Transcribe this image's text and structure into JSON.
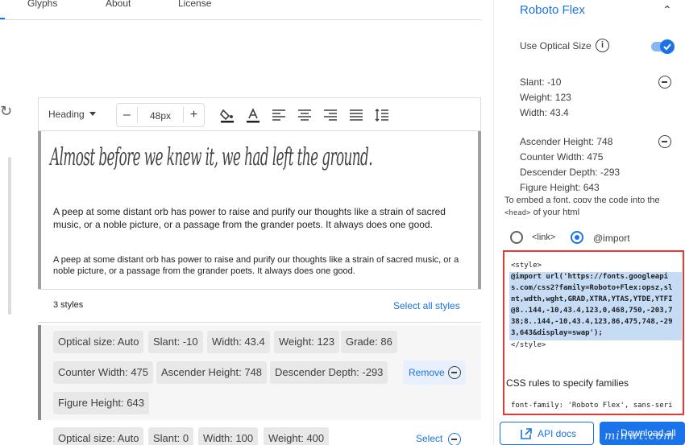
{
  "tabs": [
    "Glyphs",
    "About",
    "License"
  ],
  "toolbar": {
    "heading_select": "Heading",
    "size_minus": "–",
    "size_value": "48px",
    "size_plus": "+",
    "icons": [
      "fill-color-icon",
      "text-color-icon",
      "align-left-icon",
      "align-center-icon",
      "align-right-icon",
      "align-justify-icon",
      "line-height-icon"
    ]
  },
  "preview": {
    "heading": "Almost before we knew it, we had left the ground.",
    "paragraph_large": "A peep at some distant orb has power to raise and purify our thoughts like a strain of sacred music, or a noble picture, or a passage from the grander poets. It always does one good.",
    "paragraph_small": "A peep at some distant orb has power to raise and purify our thoughts like a strain of sacred music, or a noble picture, or a passage from the grander poets. It always does one good."
  },
  "styles": {
    "count_label": "3 styles",
    "select_all": "Select all styles",
    "style1_chips": [
      "Optical size: Auto",
      "Slant: -10",
      "Width: 43.4",
      "Weight: 123",
      "Grade: 86",
      "Counter Width: 475",
      "Ascender Height: 748",
      "Descender Depth: -293",
      "Figure Height: 643"
    ],
    "remove_label": "Remove",
    "style2_chips": [
      "Optical size: Auto",
      "Slant: 0",
      "Width: 100",
      "Weight: 400"
    ],
    "select_label": "Select"
  },
  "panel": {
    "family": "Roboto Flex",
    "optical_size_label": "Use Optical Size",
    "optical_size_on": true,
    "group1": [
      "Slant: -10",
      "Weight: 123",
      "Width: 43.4"
    ],
    "group2": [
      "Ascender Height: 748",
      "Counter Width: 475",
      "Descender Depth: -293",
      "Figure Height: 643"
    ],
    "embed_hint": "To embed a font, copy the code into the",
    "embed_hint_code": "<head>",
    "embed_hint_tail": " of your html",
    "radio_link": "<link>",
    "radio_import": "@import",
    "code_lines": [
      "<style>",
      "@import url('https://fonts.googleapi",
      "s.com/css2?family=Roboto+Flex:opsz,sl",
      "nt,wdth,wght,GRAD,XTRA,YTAS,YTDE,YTFI",
      "@8..144,-10,43.4,123,0,468,750,-203,7",
      "38;8..144,-10,43.4,123,86,475,748,-29",
      "3,643&display=swap');",
      "</style>"
    ],
    "css_rules_label": "CSS rules to specify families",
    "css_rule_code": "font-family: 'Roboto Flex', sans-seri",
    "api_docs": "API docs",
    "download_all": "Download all"
  },
  "watermark": "minwt.com",
  "colors": {
    "accent": "#1a73e8",
    "highlight": "#c6dcf5",
    "annotation": "#e53935"
  }
}
